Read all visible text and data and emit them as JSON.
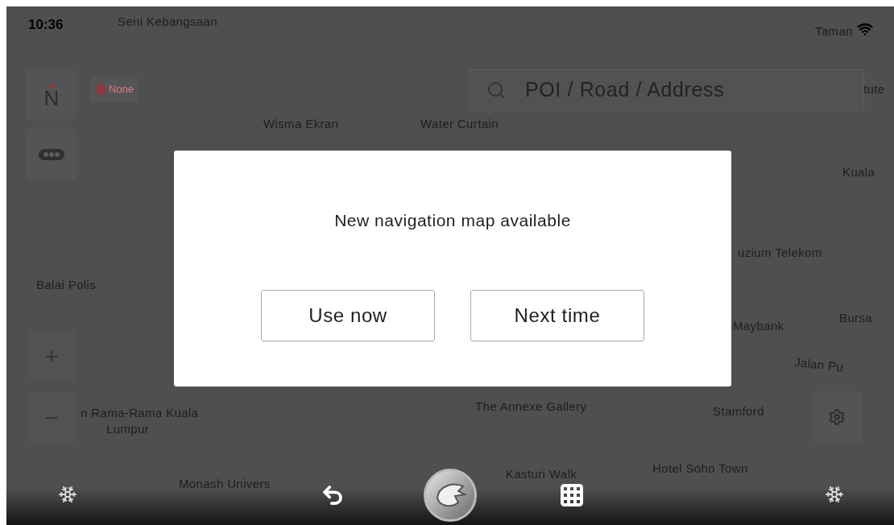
{
  "status_bar": {
    "time": "10:36"
  },
  "map_labels": [
    {
      "text": "Seni Kebangsaan"
    },
    {
      "text": "Wisma Ekran"
    },
    {
      "text": "Water Curtain"
    },
    {
      "text": "Taman"
    },
    {
      "text": "tute"
    },
    {
      "text": "Kuala"
    },
    {
      "text": "uzium Telekom"
    },
    {
      "text": "Balai Polis"
    },
    {
      "text": "Maybank"
    },
    {
      "text": "Bursa"
    },
    {
      "text": "Jalan Pu"
    },
    {
      "text": "n Rama-Rama Kuala"
    },
    {
      "text": "Lumpur"
    },
    {
      "text": "The Annexe Gallery"
    },
    {
      "text": "Stamford"
    },
    {
      "text": "Hotel Soho Town"
    },
    {
      "text": "Kasturi Walk"
    },
    {
      "text": "Monash Univers"
    }
  ],
  "compass": {
    "label": "N"
  },
  "route_pref": {
    "label": "None"
  },
  "search": {
    "placeholder": "POI / Road / Address"
  },
  "zoom": {
    "in": "+",
    "out": "−"
  },
  "dialog": {
    "message": "New navigation map available",
    "buttons": [
      {
        "label": "Use now"
      },
      {
        "label": "Next time"
      }
    ]
  }
}
